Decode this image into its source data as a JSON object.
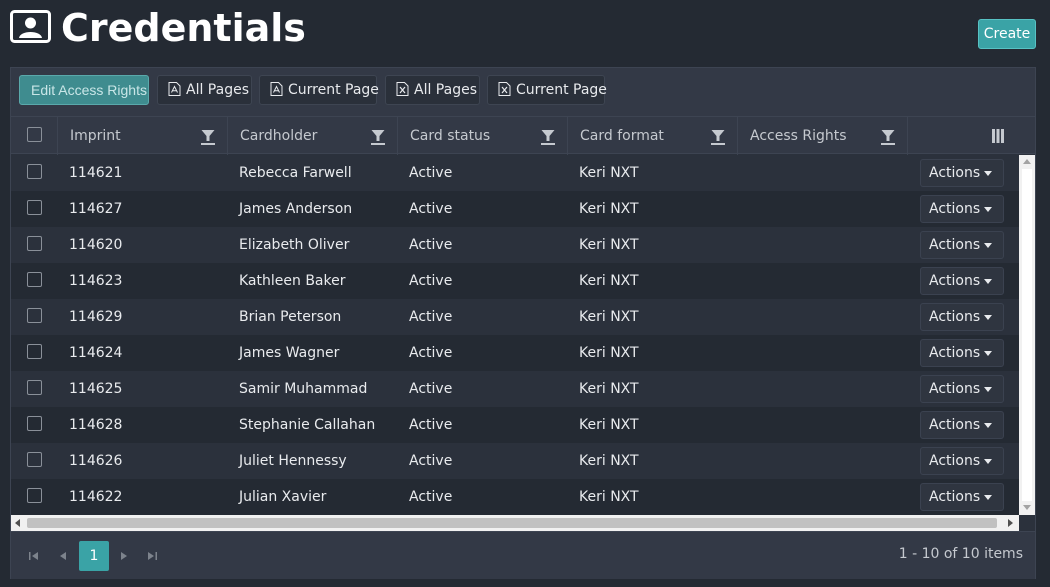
{
  "page": {
    "title": "Credentials",
    "create_label": "Create"
  },
  "toolbar": {
    "edit_access_rights": "Edit Access Rights",
    "pdf_all_pages": "All Pages",
    "pdf_current_page": "Current Page",
    "excel_all_pages": "All Pages",
    "excel_current_page": "Current Page"
  },
  "columns": [
    "Imprint",
    "Cardholder",
    "Card status",
    "Card format",
    "Access Rights"
  ],
  "rows": [
    {
      "imprint": "114621",
      "cardholder": "Rebecca Farwell",
      "status": "Active",
      "format": "Keri NXT",
      "access": "",
      "actions": "Actions"
    },
    {
      "imprint": "114627",
      "cardholder": "James Anderson",
      "status": "Active",
      "format": "Keri NXT",
      "access": "",
      "actions": "Actions"
    },
    {
      "imprint": "114620",
      "cardholder": "Elizabeth Oliver",
      "status": "Active",
      "format": "Keri NXT",
      "access": "",
      "actions": "Actions"
    },
    {
      "imprint": "114623",
      "cardholder": "Kathleen Baker",
      "status": "Active",
      "format": "Keri NXT",
      "access": "",
      "actions": "Actions"
    },
    {
      "imprint": "114629",
      "cardholder": "Brian Peterson",
      "status": "Active",
      "format": "Keri NXT",
      "access": "",
      "actions": "Actions"
    },
    {
      "imprint": "114624",
      "cardholder": "James Wagner",
      "status": "Active",
      "format": "Keri NXT",
      "access": "",
      "actions": "Actions"
    },
    {
      "imprint": "114625",
      "cardholder": "Samir Muhammad",
      "status": "Active",
      "format": "Keri NXT",
      "access": "",
      "actions": "Actions"
    },
    {
      "imprint": "114628",
      "cardholder": "Stephanie Callahan",
      "status": "Active",
      "format": "Keri NXT",
      "access": "",
      "actions": "Actions"
    },
    {
      "imprint": "114626",
      "cardholder": "Juliet Hennessy",
      "status": "Active",
      "format": "Keri NXT",
      "access": "",
      "actions": "Actions"
    },
    {
      "imprint": "114622",
      "cardholder": "Julian Xavier",
      "status": "Active",
      "format": "Keri NXT",
      "access": "",
      "actions": "Actions"
    }
  ],
  "pager": {
    "current_page": "1",
    "info": "1 - 10 of 10 items"
  },
  "icons": {
    "title": "contact-card-icon",
    "pdf": "pdf-file-icon",
    "excel": "excel-file-icon",
    "filter": "filter-icon",
    "column_menu": "columns-icon"
  },
  "colors": {
    "accent": "#3aa3a6",
    "background": "#242a33",
    "panel": "#2b313c"
  }
}
